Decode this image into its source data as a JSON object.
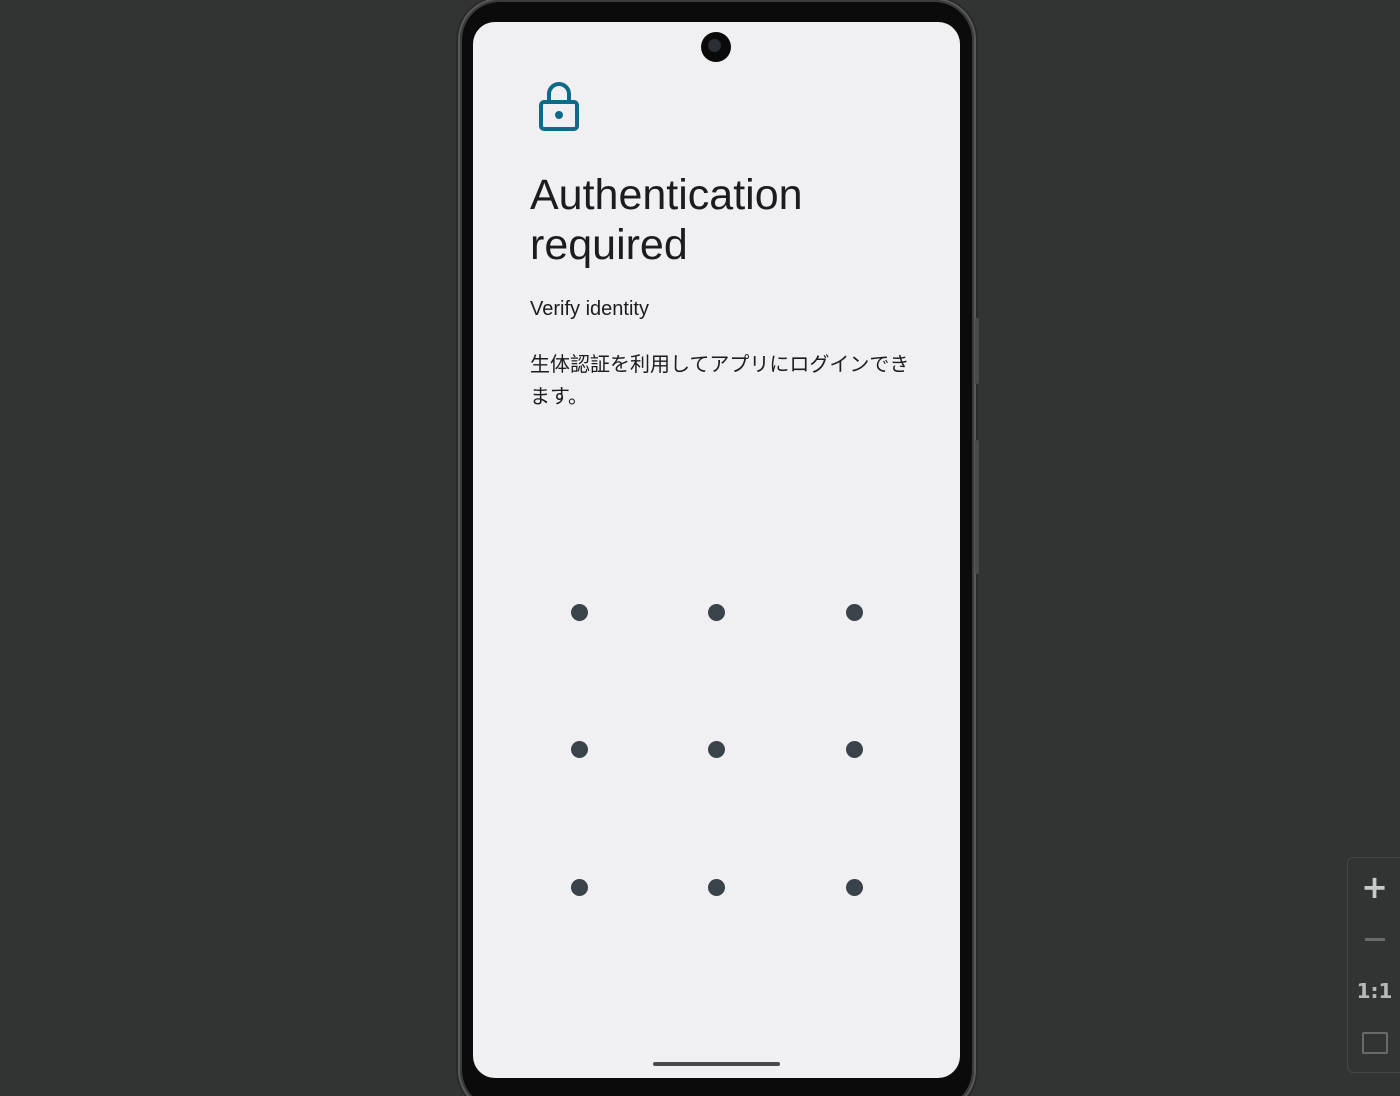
{
  "lock_screen": {
    "icon": "lock-icon",
    "accent_color": "#0f6a87",
    "title": "Authentication required",
    "subtitle": "Verify identity",
    "description": "生体認証を利用してアプリにログインできます。",
    "pattern_dots": 9
  },
  "emulator_controls": {
    "zoom_in_icon": "plus-icon",
    "zoom_out_icon": "minus-icon",
    "actual_size_label": "1:1",
    "fit_icon": "fit-screen-icon"
  }
}
